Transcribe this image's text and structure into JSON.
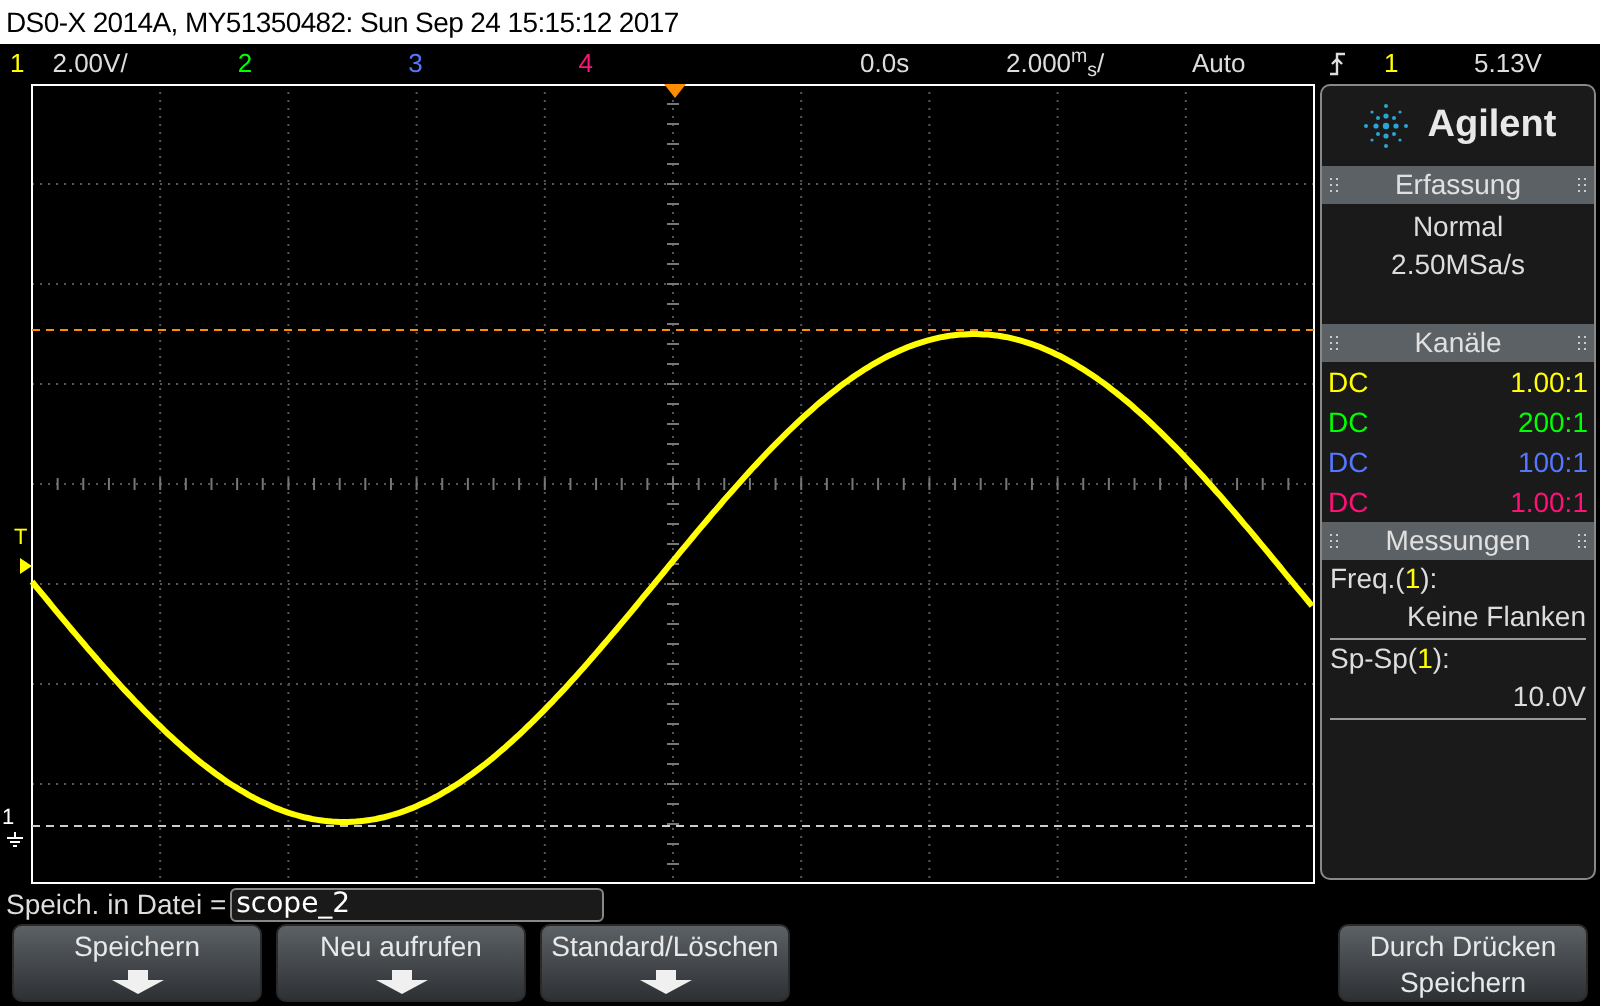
{
  "window": {
    "title": "DS0-X 2014A, MY51350482: Sun Sep 24 15:15:12 2017"
  },
  "status_bar": {
    "channels": [
      {
        "label": "1",
        "scale": "2.00V/",
        "color": "#ffff00"
      },
      {
        "label": "2",
        "color": "#00ff00"
      },
      {
        "label": "3",
        "color": "#5577ff"
      },
      {
        "label": "4",
        "color": "#ff1177"
      }
    ],
    "time_offset": "0.0s",
    "time_scale": "2.000$^{m}$$_{s}$/",
    "trigger_mode": "Auto",
    "trigger_source": "1",
    "trigger_level": "5.13V"
  },
  "graticule": {
    "trigger_marker": "T",
    "ground_marker": "1"
  },
  "panel": {
    "brand": "Agilent",
    "acquisition": {
      "title": "Erfassung",
      "mode": "Normal",
      "rate": "2.50MSa/s"
    },
    "channels": {
      "title": "Kanäle",
      "rows": [
        {
          "coupling": "DC",
          "probe": "1.00:1",
          "color": "#ffff00"
        },
        {
          "coupling": "DC",
          "probe": "200:1",
          "color": "#00ff00"
        },
        {
          "coupling": "DC",
          "probe": "100:1",
          "color": "#5577ff"
        },
        {
          "coupling": "DC",
          "probe": "1.00:1",
          "color": "#ff1177"
        }
      ]
    },
    "measurements": {
      "title": "Messungen",
      "items": [
        {
          "prefix": "Freq.(",
          "source": "1",
          "suffix": "):",
          "value": "Keine Flanken"
        },
        {
          "prefix": "Sp-Sp(",
          "source": "1",
          "suffix": "):",
          "value": "10.0V"
        }
      ]
    }
  },
  "footer": {
    "save_label": "Speich. in Datei =",
    "filename": "scope_2",
    "softkeys": [
      {
        "label": "Speichern",
        "kind": "arrow"
      },
      {
        "label": "Neu aufrufen",
        "kind": "arrow"
      },
      {
        "label": "Standard/Löschen",
        "kind": "arrow"
      },
      {
        "label": "Durch Drücken Speichern",
        "kind": "plain"
      }
    ]
  }
}
